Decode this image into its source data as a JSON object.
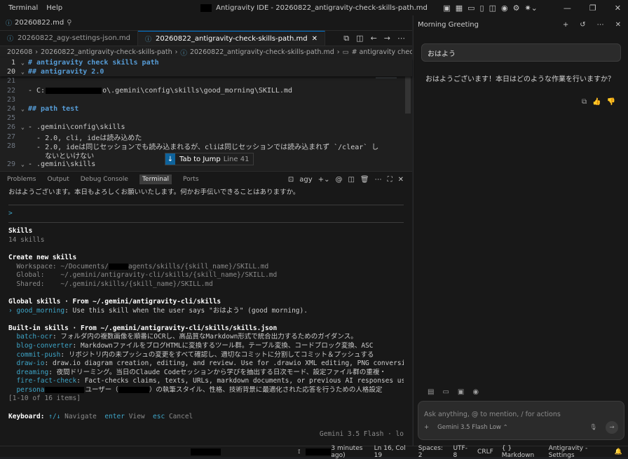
{
  "menu": [
    "Terminal",
    "Help"
  ],
  "window_title": "Antigravity IDE - 20260822_antigravity-check-skills-path.md",
  "editor": {
    "pinned_tab": "20260822.md",
    "tabs": [
      {
        "label": "20260822_agy-settings-json.md",
        "active": false
      },
      {
        "label": "20260822_antigravity-check-skills-path.md",
        "active": true
      }
    ],
    "breadcrumb": [
      "202608",
      "20260822_antigravity-check-skills-path",
      "20260822_antigravity-check-skills-path.md",
      "# antigravity check skills path"
    ],
    "sticky_lines": [
      {
        "n": "1",
        "text": "# antigravity check skills path"
      },
      {
        "n": "20",
        "text": "## antigravity 2.0"
      }
    ],
    "lines": [
      {
        "n": "21",
        "text": ""
      },
      {
        "n": "22",
        "pre": "- C:",
        "post": "o\\.gemini\\config\\skills\\good_morning\\SKILL.md"
      },
      {
        "n": "23",
        "text": ""
      },
      {
        "n": "24",
        "text": "## path test",
        "heading": true
      },
      {
        "n": "25",
        "text": ""
      },
      {
        "n": "26",
        "text": "- .gemini\\config\\skills"
      },
      {
        "n": "27",
        "text": "  - 2.0, cli, ideは読み込めた"
      },
      {
        "n": "28",
        "text": "  - 2.0, ideは同じセッションでも読み込まれるが、cliは同じセッションでは読み込まれず `/clear` し"
      },
      {
        "n": "",
        "text": "    ないといけない"
      },
      {
        "n": "29",
        "text": "- .gemini\\skills"
      }
    ],
    "jump_hint": {
      "label": "Tab to Jump",
      "line": "Line 41"
    }
  },
  "panel": {
    "tabs": [
      "Problems",
      "Output",
      "Debug Console",
      "Terminal",
      "Ports"
    ],
    "active_tab": "Terminal",
    "terminal_name": "agy"
  },
  "terminal": {
    "greeting": "おはようございます。本日もよろしくお願いいたします。何かお手伝いできることはありますか。",
    "prompt": ">",
    "skills_title": "Skills",
    "skills_count": "14 skills",
    "create_title": "Create new skills",
    "create_rows": [
      {
        "k": "Workspace:",
        "pre": "~/Documents/",
        "post": "agents/skills/{skill_name}/SKILL.md"
      },
      {
        "k": "Global:",
        "pre": "~/.gemini/antigravity-cli/skills/{skill_name}/SKILL.md",
        "post": ""
      },
      {
        "k": "Shared:",
        "pre": "~/.gemini/skills/{skill_name}/SKILL.md",
        "post": ""
      }
    ],
    "global_title": "Global skills · From ~/.gemini/antigravity-cli/skills",
    "global_item": {
      "name": "good_morning",
      "desc": ": Use this skill when the user says \"おはよう\" (good morning)."
    },
    "builtin_title": "Built-in skills · From ~/.gemini/antigravity-cli/skills/skills.json",
    "builtin": [
      {
        "name": "batch-ocr",
        "desc": ": フォルダ内の複数画像を順番にOCRし、高品質なMarkdown形式で統合出力するためのガイダンス。"
      },
      {
        "name": "blog-converter",
        "desc": ": MarkdownファイルをブログHTMLに変換するツール群。テーブル変換、コードブロック変換、ASC"
      },
      {
        "name": "commit-push",
        "desc": ": リポジトリ内の未プッシュの変更をすべて確認し、適切なコミットに分割してコミット＆プッシュする"
      },
      {
        "name": "draw-io",
        "desc": ": draw.io diagram creation, editing, and review. Use for .drawio XML editing, PNG conversion, la..."
      },
      {
        "name": "dreaming",
        "desc": ": 夜間ドリーミング。当日のClaude Codeセッションから学びを抽出する日次モード、設定ファイル群の重複・"
      },
      {
        "name": "fire-fact-check",
        "desc": ": Fact-checks claims, texts, URLs, markdown documents, or previous AI responses using th..."
      },
      {
        "name": "persona",
        "desc": "ユーザー（",
        "desc2": "）の執筆スタイル、性格、技術背景に最適化された応答を行うための人格設定"
      }
    ],
    "items_range": "[1-10 of 16 items]",
    "keyboard_label": "Keyboard:",
    "keyboard_hint1": "↑/↓",
    "keyboard_nav": "Navigate",
    "keyboard_enter": "enter",
    "keyboard_view": "View",
    "keyboard_esc": "esc",
    "keyboard_cancel": "Cancel",
    "model_hint": "Gemini 3.5 Flash · lo"
  },
  "statusbar": {
    "time": "3 minutes ago)",
    "position": "Ln 16, Col 19",
    "spaces": "Spaces: 2",
    "encoding": "UTF-8",
    "eol": "CRLF",
    "language": "Markdown",
    "settings": "Antigravity - Settings"
  },
  "chat": {
    "title": "Morning Greeting",
    "user_message": "おはよう",
    "assistant_reply": "おはようございます！本日はどのような作業を行いますか？",
    "input_placeholder": "Ask anything, @ to mention, / for actions",
    "model": "Gemini 3.5 Flash",
    "model_mode": "Low"
  }
}
